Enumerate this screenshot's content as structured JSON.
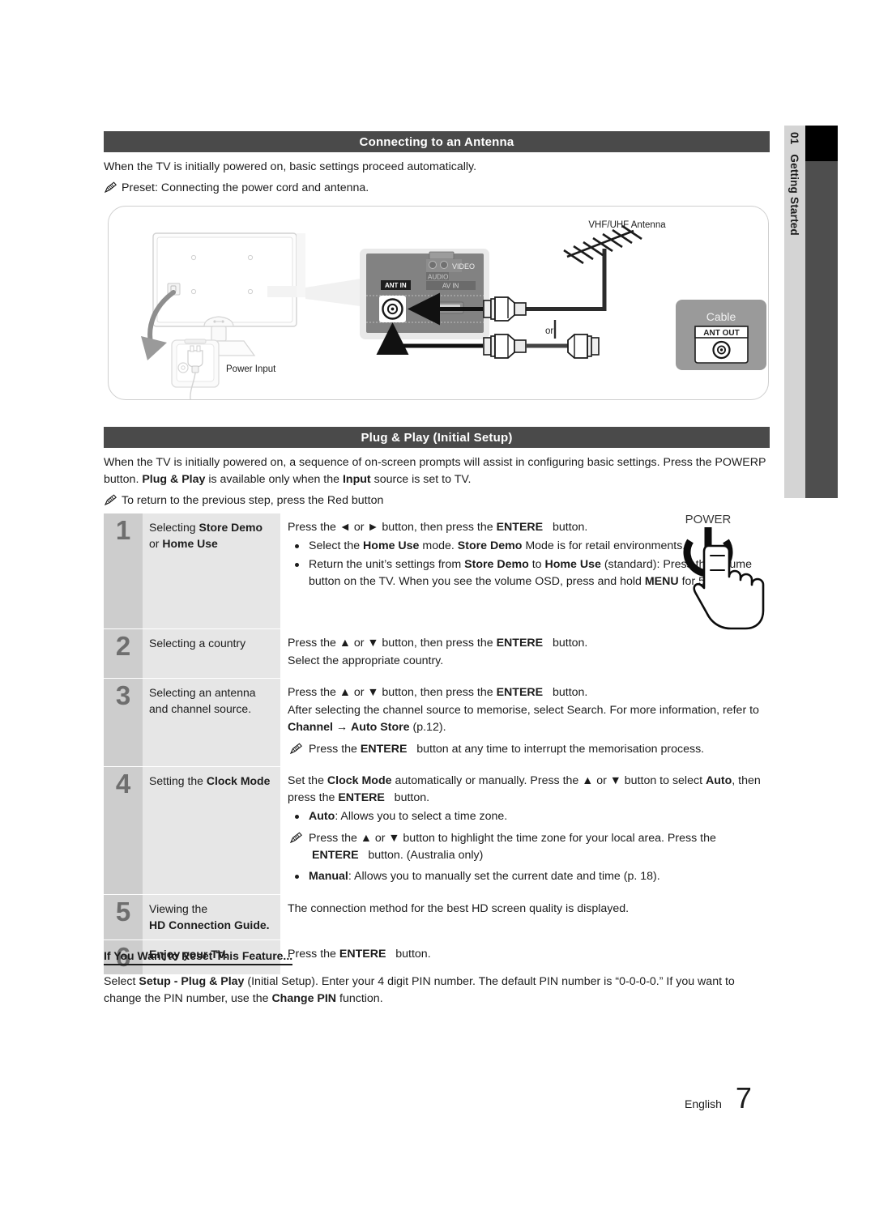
{
  "side_tab": {
    "number": "01",
    "label": "Getting Started"
  },
  "sections": {
    "antenna": {
      "title": "Connecting to an Antenna",
      "intro": "When the TV is initially powered on, basic settings proceed automatically.",
      "note": "Preset: Connecting the power cord and antenna."
    },
    "plug_play": {
      "title": "Plug & Play (Initial Setup)",
      "intro_a": "When the TV is initially powered on, a sequence of on-screen prompts will assist in configuring basic settings. Press the ",
      "intro_power": "POWERP",
      "intro_b": " button. ",
      "intro_bold1": "Plug & Play",
      "intro_c": " is available only when the ",
      "intro_bold2": "Input",
      "intro_d": " source is set to TV.",
      "note": "To return to the previous step, press the Red button"
    }
  },
  "diagram": {
    "labels": {
      "vhf_uhf_antenna": "VHF/UHF Antenna",
      "cable": "Cable",
      "ant_out": "ANT OUT",
      "ant_in": "ANT IN",
      "av_in": "AV IN",
      "audio": "AUDIO",
      "video": "VIDEO",
      "or": "or",
      "power_input": "Power Input"
    }
  },
  "steps": [
    {
      "number": "1",
      "label_a": "Selecting ",
      "label_b": "Store Demo",
      "label_c": " or ",
      "label_d": "Home Use",
      "lead": "Press the ◄ or ► button, then press the ENTERE    button.",
      "bullets": [
        "Select the Home Use mode. Store Demo Mode is for retail environments.",
        "Return the unit’s settings from Store Demo to Home Use (standard): Press the volume button on the TV. When you see the volume OSD, press and hold MENU for 5 sec."
      ]
    },
    {
      "number": "2",
      "label": "Selecting a country",
      "lead": "Press the ▲ or ▼ button, then press the ENTERE    button.",
      "line2": "Select the appropriate country."
    },
    {
      "number": "3",
      "label_line1": "Selecting an antenna",
      "label_line2": "and channel source.",
      "lead": "Press the ▲ or ▼ button, then press the ENTERE    button.",
      "line2": "After selecting the channel source to memorise, select Search. For more information, refer to Channel → Auto Store (p.12).",
      "note": "Press the ENTERE    button at any time to interrupt the memorisation process."
    },
    {
      "number": "4",
      "label_a": "Setting the ",
      "label_b": "Clock Mode",
      "lead": "Set the Clock Mode automatically or manually. Press the ▲ or ▼ button to select Auto, then press the ENTERE    button.",
      "bullet_auto": "Auto: Allows you to select a time zone.",
      "note": "Press the ▲ or ▼ button to highlight the time zone for your local area. Press the ENTERE    button. (Australia only)",
      "bullet_manual": "Manual: Allows you to manually set the current date and time (p. 18)."
    },
    {
      "number": "5",
      "label_line1": "Viewing the",
      "label_line2": "HD Connection Guide.",
      "lead": "The connection method for the best HD screen quality is displayed."
    },
    {
      "number": "6",
      "label": "Enjoy your TV.",
      "lead": "Press the ENTERE    button."
    }
  ],
  "reset": {
    "title": "If You Want to Reset This Feature...",
    "text_a": "Select ",
    "text_bold1": "Setup - Plug & Play",
    "text_b": " (Initial Setup). Enter your 4 digit PIN number. The default PIN number is “0-0-0-0.” If you want to change the PIN number, use the ",
    "text_bold2": "Change PIN",
    "text_c": " function."
  },
  "power_graphic": {
    "label": "POWER"
  },
  "footer": {
    "language": "English",
    "page": "7"
  },
  "colors": {
    "header_bar": "#4a4a4a",
    "tab_light": "#d4d4d4",
    "tab_dark": "#4e4e4e",
    "step_number_bg": "#cdcdcd",
    "step_label_bg": "#e6e6e6",
    "text": "#1c1c1c"
  }
}
